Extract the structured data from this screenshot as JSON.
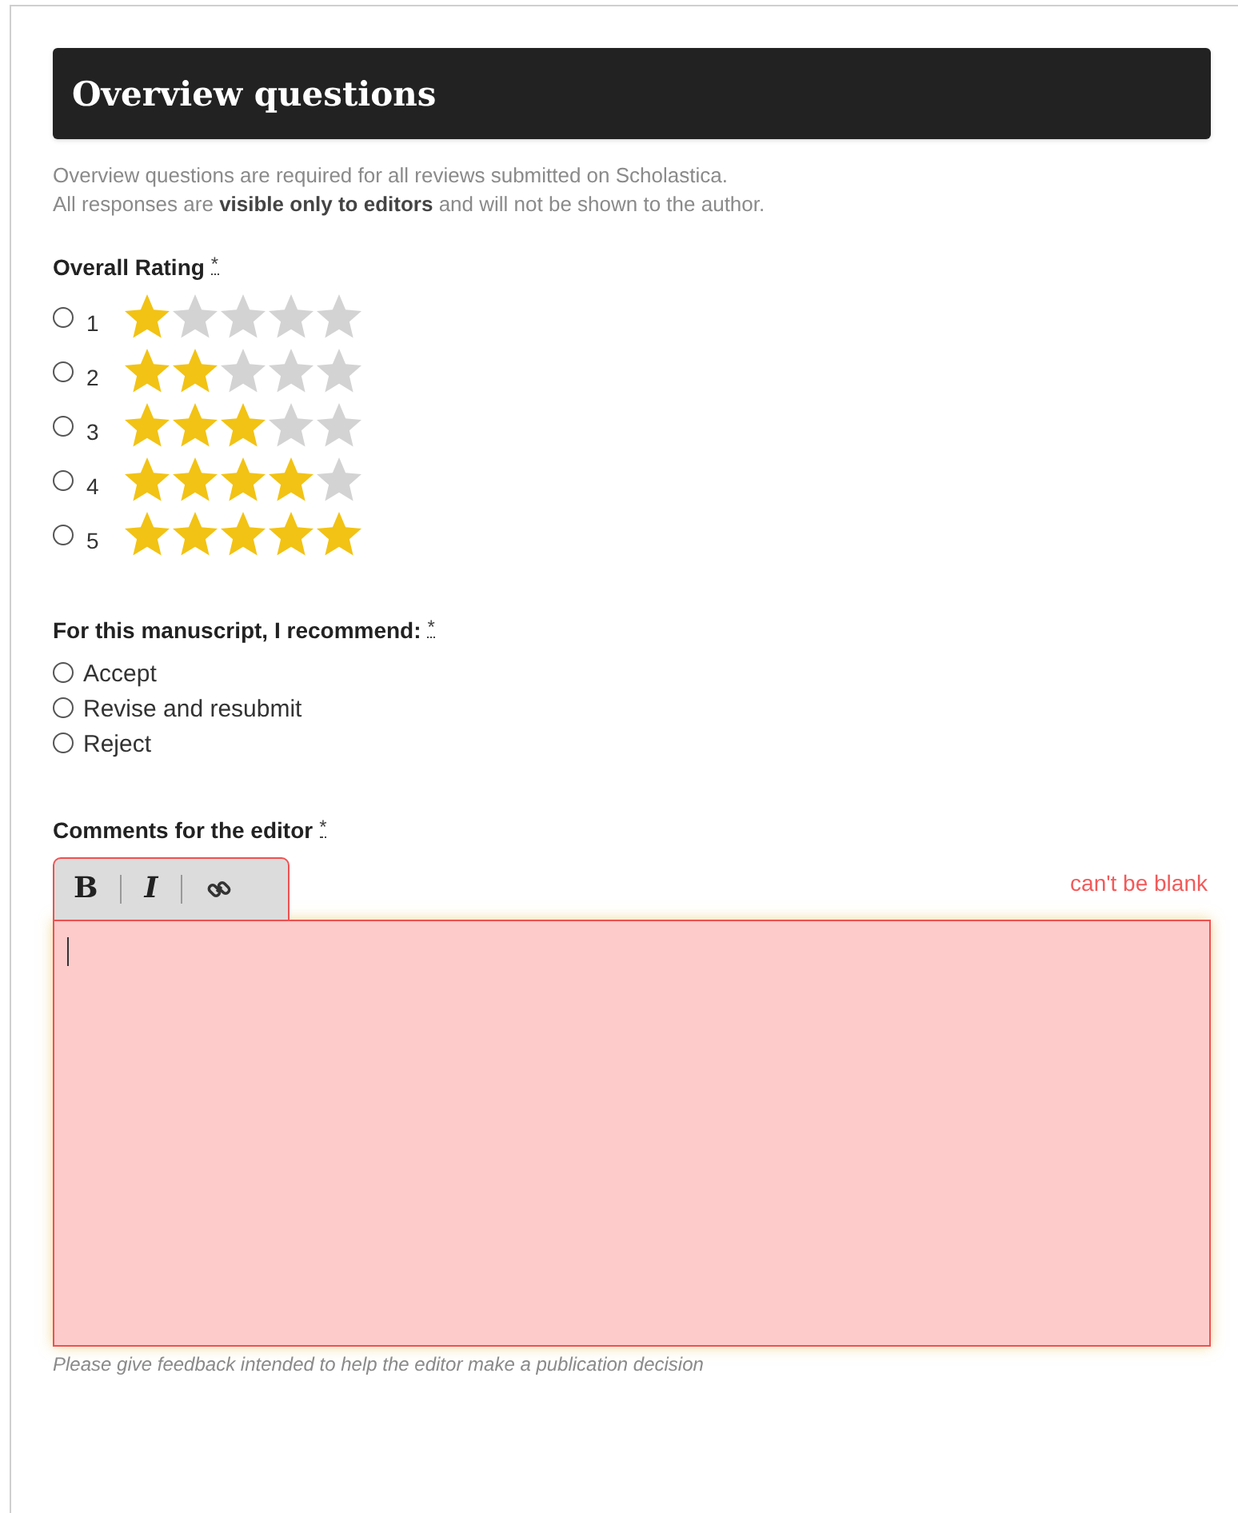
{
  "header": {
    "title": "Overview questions"
  },
  "intro": [
    "Overview questions are required for all reviews submitted on Scholastica.",
    "All responses are **visible only to editors** and will not be shown to the author."
  ],
  "rating": {
    "label": "Overall Rating",
    "required_mark": "*",
    "options": [
      {
        "label": "1",
        "stars": 1,
        "selected": false
      },
      {
        "label": "2",
        "stars": 2,
        "selected": false
      },
      {
        "label": "3",
        "stars": 3,
        "selected": false
      },
      {
        "label": "4",
        "stars": 4,
        "selected": false
      },
      {
        "label": "5",
        "stars": 5,
        "selected": false
      }
    ]
  },
  "recommendation": {
    "label": "For this manuscript, I recommend:",
    "required_mark": "*",
    "options": [
      {
        "label": "Accept",
        "selected": false
      },
      {
        "label": "Revise and resubmit",
        "selected": false
      },
      {
        "label": "Reject",
        "selected": false
      }
    ]
  },
  "comments": {
    "label": "Comments for the editor",
    "required_mark": "*",
    "toolbar": [
      {
        "kind": "bold",
        "label": "B"
      },
      {
        "kind": "italic",
        "label": "I"
      },
      {
        "kind": "link"
      }
    ],
    "error": "can't be blank",
    "hint": "Please give feedback intended to help the editor make a publication decision"
  }
}
